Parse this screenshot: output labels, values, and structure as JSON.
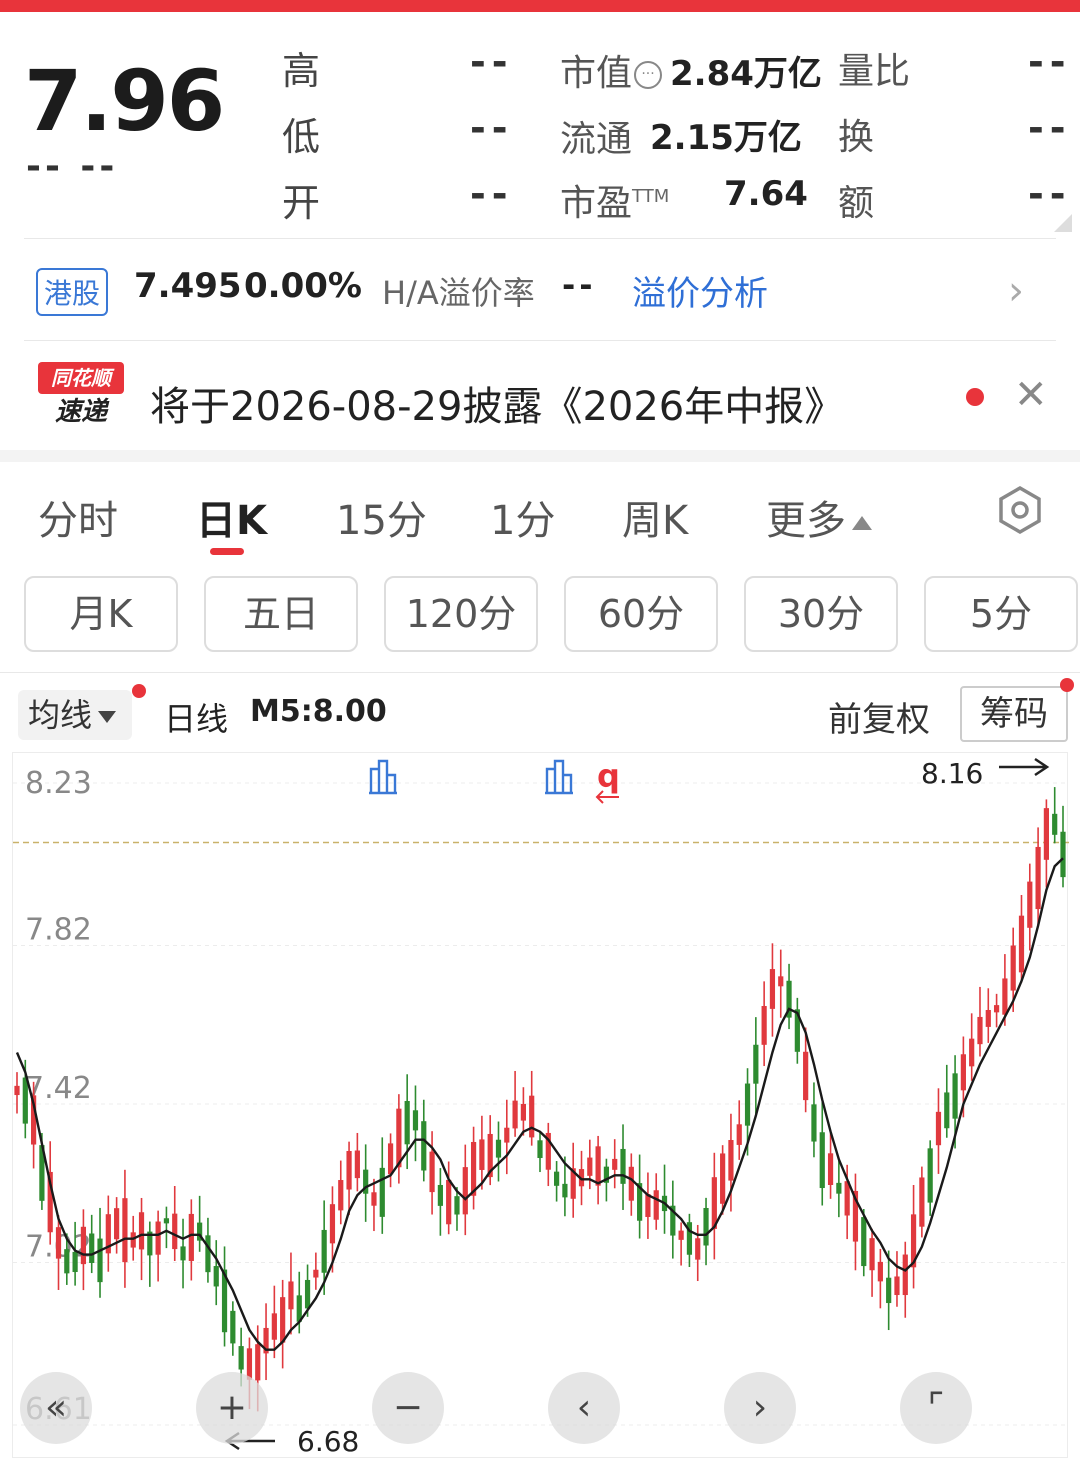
{
  "quote": {
    "price": "7.96",
    "price_change": "-- --",
    "high_label": "高",
    "high_value": "--",
    "low_label": "低",
    "low_value": "--",
    "open_label": "开",
    "open_value": "--",
    "mktcap_label": "市值",
    "mktcap_value": "2.84万亿",
    "float_label": "流通",
    "float_value": "2.15万亿",
    "pe_label": "市盈",
    "pe_sup": "TTM",
    "pe_value": "7.64",
    "volratio_label": "量比",
    "volratio_value": "--",
    "turnover_label": "换",
    "turnover_value": "--",
    "amount_label": "额",
    "amount_value": "--",
    "info_icon": "info-icon"
  },
  "hk": {
    "badge": "港股",
    "price": "7.495",
    "change": "0.00%",
    "premium_label": "H/A溢价率",
    "premium_value": "--",
    "link": "溢价分析"
  },
  "news": {
    "logo_top": "同花顺",
    "logo_bottom": "速递",
    "text": "将于2026-08-29披露《2026年中报》"
  },
  "tabs": [
    {
      "label": "分时"
    },
    {
      "label": "日K"
    },
    {
      "label": "15分"
    },
    {
      "label": "1分"
    },
    {
      "label": "周K"
    },
    {
      "label": "更多"
    }
  ],
  "periods": [
    "月K",
    "五日",
    "120分",
    "60分",
    "30分",
    "5分"
  ],
  "chart_toolbar": {
    "indicator": "均线",
    "line_type": "日线",
    "ma_text": "M5:8.00",
    "adjust": "前复权",
    "chip": "筹码"
  },
  "chart_data": {
    "type": "candlestick",
    "y_ticks": [
      "8.23",
      "7.82",
      "7.42",
      "7.02",
      "6.61"
    ],
    "ylim": [
      6.61,
      8.23
    ],
    "prev_close_ref": 8.08,
    "max_label": "8.16",
    "min_label": "6.68",
    "close_path": [
      7.46,
      7.4,
      7.32,
      7.2,
      7.1,
      7.05,
      7.02,
      7.0,
      7.08,
      7.03,
      7.06,
      7.1,
      7.12,
      7.05,
      7.08,
      7.11,
      7.06,
      7.1,
      7.12,
      7.08,
      7.06,
      7.14,
      7.09,
      7.0,
      6.96,
      6.88,
      6.82,
      6.78,
      6.74,
      6.78,
      6.83,
      6.86,
      6.9,
      6.95,
      6.92,
      6.97,
      7.0,
      7.08,
      7.15,
      7.22,
      7.3,
      7.26,
      7.2,
      7.18,
      7.24,
      7.3,
      7.36,
      7.4,
      7.36,
      7.28,
      7.22,
      7.17,
      7.13,
      7.18,
      7.22,
      7.3,
      7.26,
      7.32,
      7.3,
      7.36,
      7.4,
      7.38,
      7.34,
      7.3,
      7.27,
      7.23,
      7.2,
      7.24,
      7.22,
      7.26,
      7.22,
      7.25,
      7.28,
      7.24,
      7.2,
      7.16,
      7.14,
      7.18,
      7.15,
      7.1,
      7.08,
      7.04,
      7.08,
      7.15,
      7.2,
      7.26,
      7.3,
      7.36,
      7.46,
      7.56,
      7.65,
      7.72,
      7.74,
      7.66,
      7.56,
      7.44,
      7.33,
      7.25,
      7.22,
      7.2,
      7.16,
      7.1,
      7.06,
      7.03,
      7.0,
      6.96,
      6.98,
      7.04,
      7.12,
      7.22,
      7.3,
      7.38,
      7.42,
      7.48,
      7.52,
      7.58,
      7.6,
      7.64,
      7.66,
      7.7,
      7.78,
      7.86,
      7.94,
      8.06,
      8.12,
      8.1,
      8.04
    ],
    "ma5_path": [
      7.55,
      7.5,
      7.42,
      7.32,
      7.22,
      7.13,
      7.08,
      7.05,
      7.04,
      7.04,
      7.05,
      7.06,
      7.07,
      7.08,
      7.08,
      7.09,
      7.09,
      7.09,
      7.1,
      7.09,
      7.08,
      7.09,
      7.09,
      7.06,
      7.03,
      6.99,
      6.95,
      6.9,
      6.85,
      6.82,
      6.8,
      6.8,
      6.82,
      6.85,
      6.87,
      6.9,
      6.93,
      6.97,
      7.02,
      7.08,
      7.15,
      7.19,
      7.21,
      7.22,
      7.23,
      7.24,
      7.27,
      7.3,
      7.33,
      7.33,
      7.31,
      7.28,
      7.23,
      7.2,
      7.18,
      7.2,
      7.22,
      7.25,
      7.27,
      7.29,
      7.32,
      7.35,
      7.36,
      7.35,
      7.33,
      7.3,
      7.27,
      7.25,
      7.23,
      7.23,
      7.22,
      7.23,
      7.24,
      7.24,
      7.23,
      7.21,
      7.19,
      7.18,
      7.17,
      7.15,
      7.13,
      7.1,
      7.09,
      7.09,
      7.11,
      7.15,
      7.2,
      7.26,
      7.32,
      7.39,
      7.47,
      7.55,
      7.62,
      7.66,
      7.65,
      7.6,
      7.52,
      7.43,
      7.35,
      7.28,
      7.23,
      7.18,
      7.14,
      7.1,
      7.07,
      7.03,
      7.01,
      7.0,
      7.02,
      7.06,
      7.12,
      7.19,
      7.26,
      7.34,
      7.42,
      7.47,
      7.52,
      7.56,
      7.6,
      7.64,
      7.68,
      7.73,
      7.79,
      7.87,
      7.96,
      8.02,
      8.04
    ]
  },
  "controls": {
    "rewind": "«",
    "zoom_in": "+",
    "zoom_out": "−",
    "prev": "‹",
    "next": "›",
    "fullscreen": "⌜"
  },
  "colors": {
    "accent": "#e8343b",
    "up": "#e0393e",
    "down": "#2e8b30",
    "link": "#2f6fd6"
  }
}
